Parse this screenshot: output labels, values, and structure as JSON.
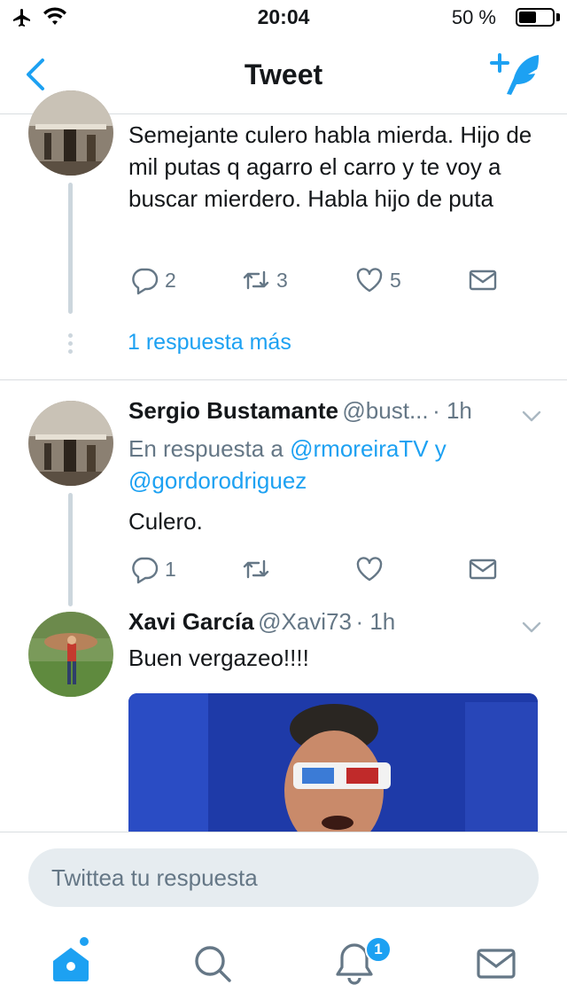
{
  "status_bar": {
    "time": "20:04",
    "battery": "50 %"
  },
  "nav": {
    "title": "Tweet"
  },
  "tweets": [
    {
      "text": "Semejante culero habla mierda. Hijo de mil putas q agarro el carro y te voy a buscar mierdero. Habla hijo de puta",
      "replies": "2",
      "retweets": "3",
      "likes": "5"
    },
    {
      "name": "Sergio Bustamante",
      "handle": "@bust...",
      "time": "· 1h",
      "reply_prefix": "En respuesta a",
      "reply_to_1": "@rmoreiraTV",
      "reply_join": "y",
      "reply_to_2": "@gordorodriguez",
      "text": "Culero.",
      "replies": "1",
      "retweets": "",
      "likes": ""
    },
    {
      "name": "Xavi García",
      "handle": "@Xavi73",
      "time": "· 1h",
      "text": "Buen vergazeo!!!!"
    }
  ],
  "more_replies": "1 respuesta más",
  "reply_box": {
    "placeholder": "Twittea tu respuesta"
  },
  "tab_bar": {
    "notifications_badge": "1"
  },
  "colors": {
    "accent": "#1da1f2",
    "text": "#14171a",
    "muted": "#657786",
    "thread": "#ccd6dd"
  }
}
